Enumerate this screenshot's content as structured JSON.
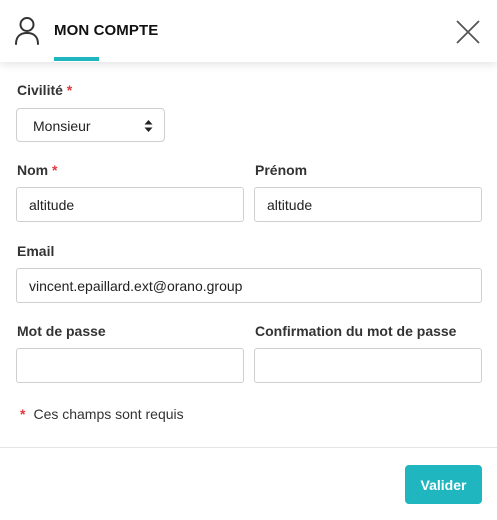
{
  "header": {
    "title": "MON COMPTE",
    "icon": "user-icon",
    "close_icon": "close-icon"
  },
  "form": {
    "civility": {
      "label": "Civilité",
      "required_mark": "*",
      "value": "Monsieur"
    },
    "nom": {
      "label": "Nom",
      "required_mark": "*",
      "value": "altitude"
    },
    "prenom": {
      "label": "Prénom",
      "value": "altitude"
    },
    "email": {
      "label": "Email",
      "value": "vincent.epaillard.ext@orano.group"
    },
    "password": {
      "label": "Mot de passe",
      "value": ""
    },
    "password_confirm": {
      "label": "Confirmation du mot de passe",
      "value": ""
    }
  },
  "required_note": {
    "mark": "*",
    "text": "Ces champs sont requis"
  },
  "footer": {
    "submit_label": "Valider"
  },
  "colors": {
    "accent": "#1fb6c0",
    "required": "#e0393e"
  }
}
